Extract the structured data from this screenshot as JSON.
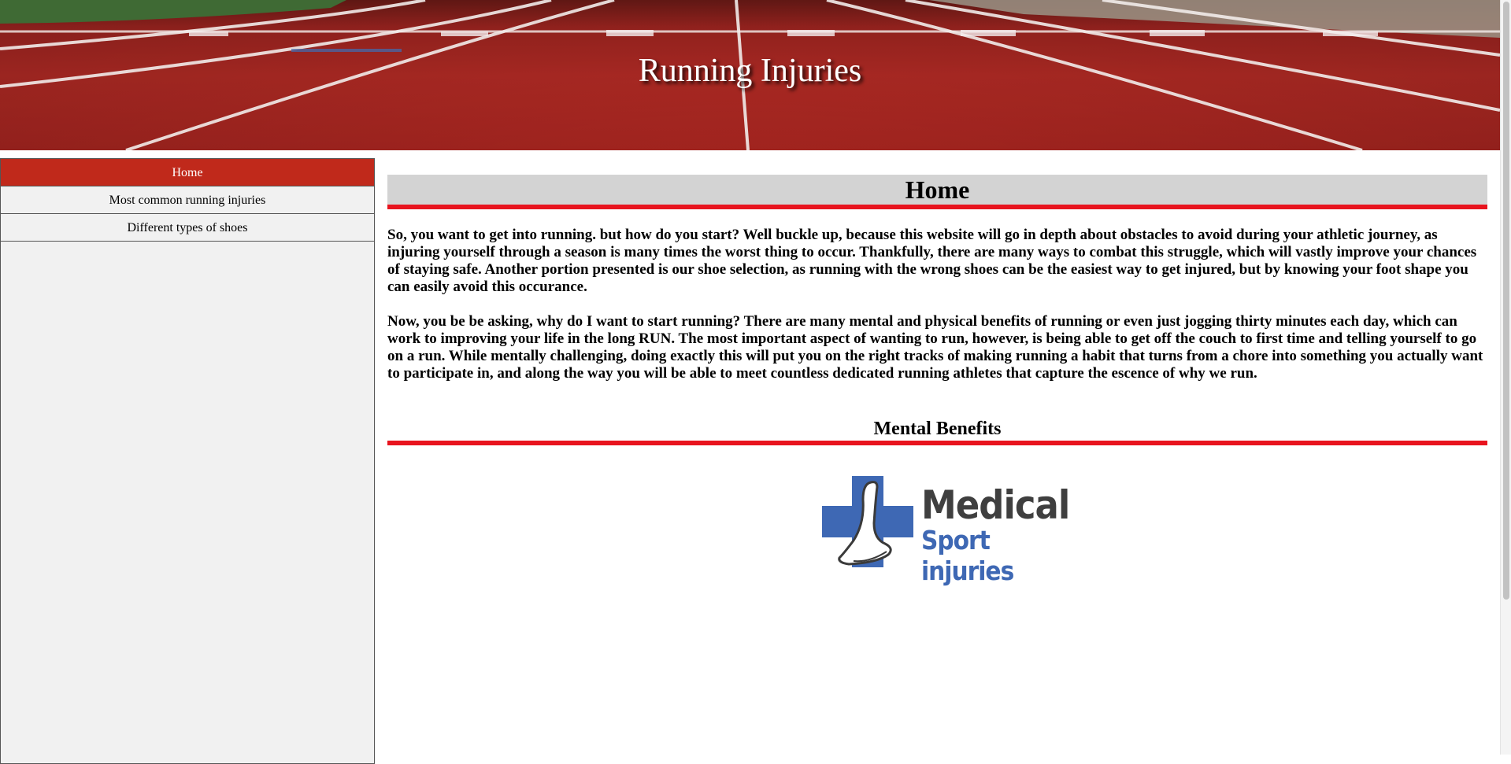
{
  "header": {
    "title": "Running Injuries"
  },
  "sidebar": {
    "items": [
      {
        "label": "Home",
        "active": true
      },
      {
        "label": "Most common running injuries",
        "active": false
      },
      {
        "label": "Different types of shoes",
        "active": false
      }
    ]
  },
  "main": {
    "heading": "Home",
    "paragraphs": [
      "So, you want to get into running. but how do you start? Well buckle up, because this website will go in depth about obstacles to avoid during your athletic journey, as injuring yourself through a season is many times the worst thing to occur. Thankfully, there are many ways to combat this struggle, which will vastly improve your chances of staying safe. Another portion presented is our shoe selection, as running with the wrong shoes can be the easiest way to get injured, but by knowing your foot shape you can easily avoid this occurance.",
      "Now, you be be asking, why do I want to start running? There are many mental and physical benefits of running or even just jogging thirty minutes each day, which can work to improving your life in the long RUN. The most important aspect of wanting to run, however, is being able to get off the couch to first time and telling yourself to go on a run. While mentally challenging, doing exactly this will put you on the right tracks of making running a habit that turns from a chore into something you actually want to participate in, and along the way you will be able to meet countless dedicated running athletes that capture the escence of why we run."
    ],
    "section_heading": "Mental Benefits",
    "logo": {
      "line1": "Medical",
      "line2": "Sport injuries",
      "icon": "foot-cross-icon"
    }
  },
  "colors": {
    "accent_red": "#e8141e",
    "nav_active": "#c0291b",
    "logo_blue": "#3e68b4",
    "logo_gray": "#3f3f3f"
  }
}
